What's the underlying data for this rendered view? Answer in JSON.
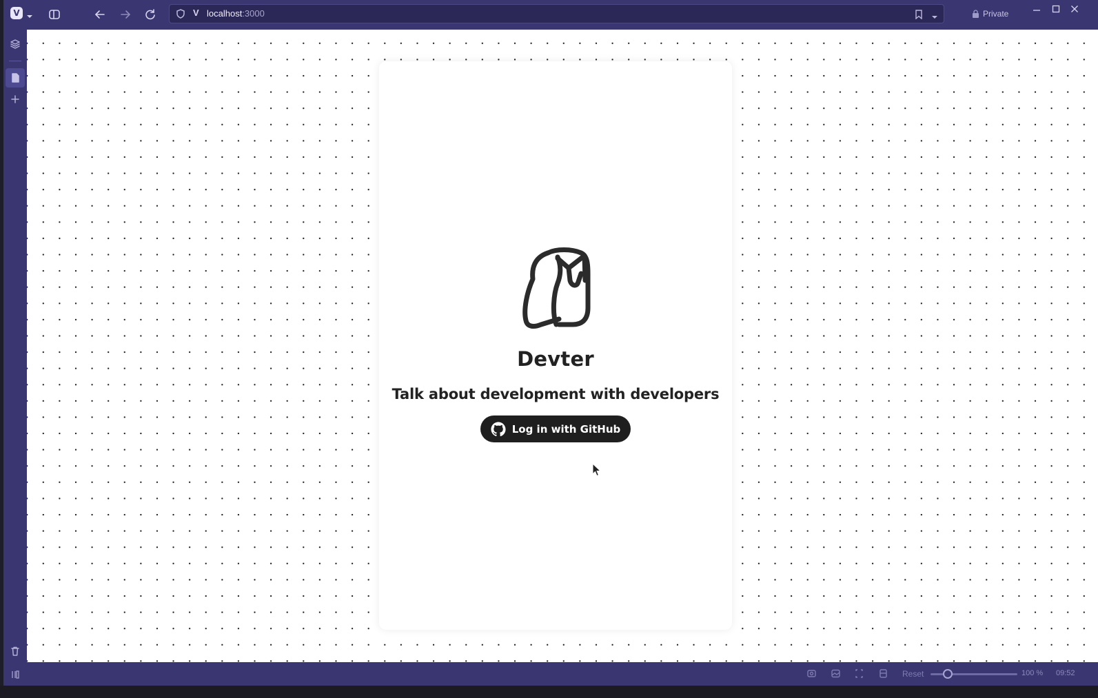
{
  "browser": {
    "address": {
      "host": "localhost",
      "port": ":3000"
    },
    "private_label": "Private",
    "status_bar": {
      "reset_label": "Reset",
      "zoom_level": "100 %",
      "zoom_fraction": 0.2,
      "clock": "09:52"
    }
  },
  "page": {
    "app_name": "Devter",
    "tagline": "Talk about development with developers",
    "login_button_label": "Log in with GitHub"
  },
  "colors": {
    "browser_chrome": "#3a3672",
    "button_bg": "#1f1f1f",
    "text": "#222222",
    "dot_pattern": "#1a1a1a"
  },
  "icons": {
    "app_logo": "owl-logo-icon",
    "button": "github-icon"
  }
}
